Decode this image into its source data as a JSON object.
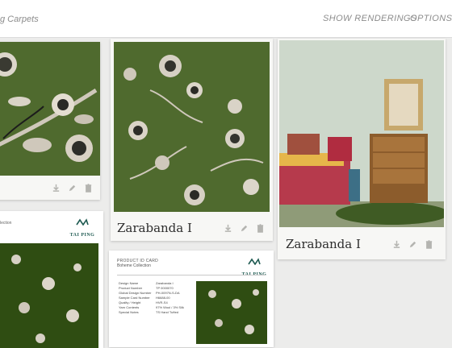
{
  "header": {
    "breadcrumb": "g Carpets",
    "show_renderings": "SHOW RENDERINGS",
    "options": "OPTIONS"
  },
  "cards": [
    {
      "title": ""
    },
    {
      "title": "Zarabanda I"
    },
    {
      "title": "Zarabanda I"
    }
  ],
  "product_card": {
    "label": "PRODUCT ID CARD",
    "collection": "Boheme Collection",
    "logo_text": "TAI PING",
    "rows": [
      {
        "k": "Design Name",
        "v": "Zarabanda I"
      },
      {
        "k": "Product Number",
        "v": "TP 0000070"
      },
      {
        "k": "Global Design Number",
        "v": "PH-0097N-S-DA"
      },
      {
        "k": "Sample Card Number",
        "v": "H6688-00"
      },
      {
        "k": "Quality / Height",
        "v": "HVR-S4"
      },
      {
        "k": "Yarn Contents",
        "v": "97% Wool / 3% Silk"
      },
      {
        "k": "Special Notes",
        "v": "TS Hand Tufted"
      }
    ]
  },
  "left_sheet": {
    "label": "lection",
    "logo_text": "TAI PING"
  },
  "colors": {
    "accent": "#1f5b52",
    "rug_green": "#4f6a2e",
    "rug_dark": "#2f4d12"
  }
}
